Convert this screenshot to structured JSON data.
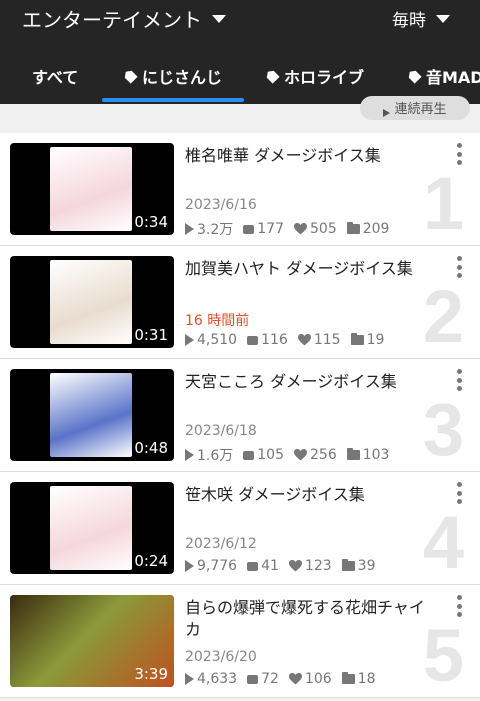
{
  "header": {
    "category": "エンターテイメント",
    "period": "毎時",
    "tabs": [
      {
        "label": "すべて",
        "tagged": false
      },
      {
        "label": "にじさんじ",
        "tagged": true
      },
      {
        "label": "ホロライブ",
        "tagged": true
      },
      {
        "label": "音MAD",
        "tagged": true
      }
    ],
    "continuous_play_label": "連続再生"
  },
  "videos": [
    {
      "rank": "1",
      "title": "椎名唯華 ダメージボイス集",
      "duration": "0:34",
      "date": "2023/6/16",
      "recent": false,
      "views": "3.2万",
      "comments": "177",
      "likes": "505",
      "mylists": "209",
      "art_color": "#f4d6de"
    },
    {
      "rank": "2",
      "title": "加賀美ハヤト ダメージボイス集",
      "duration": "0:31",
      "date": "16 時間前",
      "recent": true,
      "views": "4,510",
      "comments": "116",
      "likes": "115",
      "mylists": "19",
      "art_color": "#e8dccf"
    },
    {
      "rank": "3",
      "title": "天宮こころ ダメージボイス集",
      "duration": "0:48",
      "date": "2023/6/18",
      "recent": false,
      "views": "1.6万",
      "comments": "105",
      "likes": "256",
      "mylists": "103",
      "art_color": "#5a73c8"
    },
    {
      "rank": "4",
      "title": "笹木咲 ダメージボイス集",
      "duration": "0:24",
      "date": "2023/6/12",
      "recent": false,
      "views": "9,776",
      "comments": "41",
      "likes": "123",
      "mylists": "39",
      "art_color": "#f5d7dc"
    },
    {
      "rank": "5",
      "title": "自らの爆弾で爆死する花畑チャイカ",
      "duration": "3:39",
      "date": "2023/6/20",
      "recent": false,
      "views": "4,633",
      "comments": "72",
      "likes": "106",
      "mylists": "18",
      "art_color": "#7a8f2e"
    }
  ],
  "colors": {
    "header_bg": "#252525",
    "accent": "#2d8ef0",
    "recent_date": "#e0502d"
  }
}
